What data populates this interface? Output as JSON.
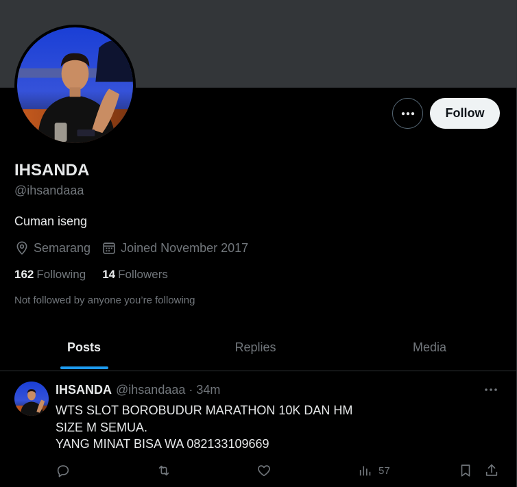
{
  "profile": {
    "name": "IHSANDA",
    "handle": "@ihsandaaa",
    "bio": "Cuman iseng",
    "location": "Semarang",
    "joined": "Joined November 2017",
    "following_count": "162",
    "following_label": "Following",
    "followers_count": "14",
    "followers_label": "Followers",
    "not_followed": "Not followed by anyone you’re following",
    "follow_label": "Follow"
  },
  "tabs": [
    {
      "label": "Posts",
      "active": true
    },
    {
      "label": "Replies",
      "active": false
    },
    {
      "label": "Media",
      "active": false
    }
  ],
  "tweet": {
    "name": "IHSANDA",
    "handle": "@ihsandaaa",
    "separator": "·",
    "time": "34m",
    "lines": [
      "WTS SLOT BOROBUDUR MARATHON 10K DAN HM",
      "SIZE M SEMUA.",
      "YANG MINAT BISA WA 082133109669"
    ],
    "views": "57"
  },
  "colors": {
    "background": "#000000",
    "banner": "#333639",
    "accent": "#1d9bf0",
    "secondary_text": "#71767b",
    "primary_text": "#e7e9ea"
  },
  "icons": {
    "more": "more-horizontal-icon",
    "location": "location-pin-icon",
    "calendar": "calendar-icon",
    "reply": "reply-icon",
    "retweet": "retweet-icon",
    "like": "heart-icon",
    "views": "views-chart-icon",
    "bookmark": "bookmark-icon",
    "share": "share-icon"
  }
}
